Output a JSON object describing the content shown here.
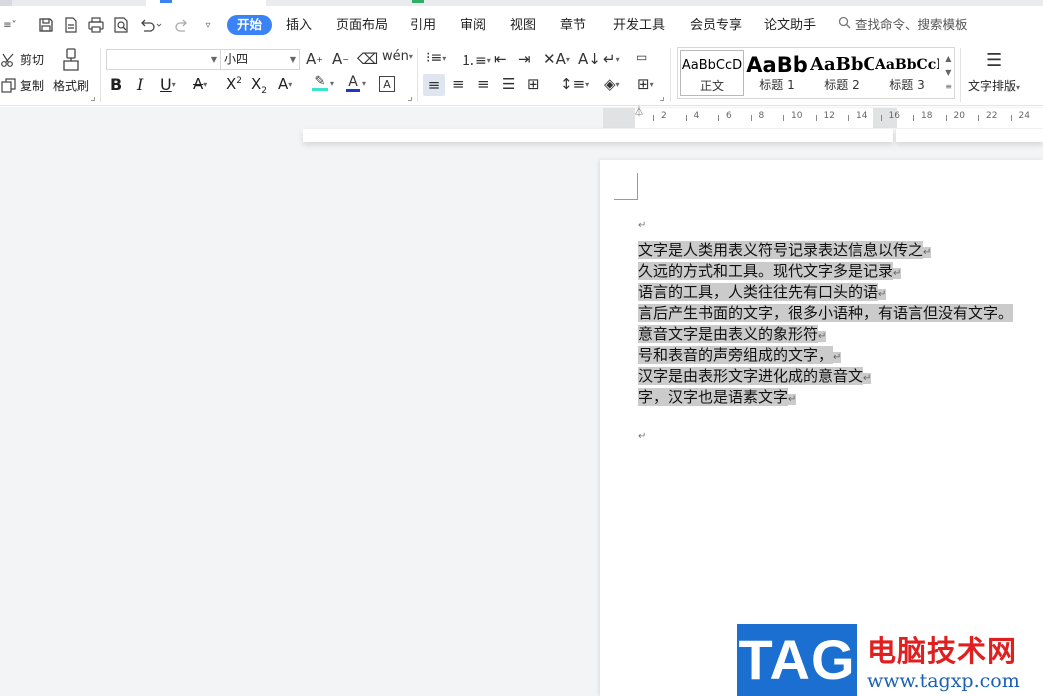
{
  "colors": {
    "accent": "#3a83f7",
    "selection": "#cbcbcb",
    "workspace": "#f3f4f5",
    "watermark_blue": "#1a6fd0",
    "watermark_red": "#e02020"
  },
  "menu": {
    "tabs": [
      "开始",
      "插入",
      "页面布局",
      "引用",
      "审阅",
      "视图",
      "章节",
      "开发工具",
      "会员专享",
      "论文助手"
    ],
    "active_tab": "开始",
    "search_label": "查找命令、搜索模板"
  },
  "quick_access": {
    "icons": [
      "save-icon",
      "export-pdf-icon",
      "print-icon",
      "print-preview-icon",
      "undo-icon",
      "redo-icon",
      "customize-icon"
    ]
  },
  "ribbon": {
    "cut_label": "剪切",
    "copy_label": "复制",
    "format_painter_label": "格式刷",
    "font_name_value": "",
    "font_size_value": "小四",
    "styles": [
      {
        "sample": "AaBbCcD",
        "name": "正文"
      },
      {
        "sample": "AaBb",
        "name": "标题 1"
      },
      {
        "sample": "AaBbC",
        "name": "标题 2"
      },
      {
        "sample": "AaBbCcI",
        "name": "标题 3"
      }
    ],
    "text_layout_label": "文字排版"
  },
  "ruler": {
    "labels": [
      "2",
      "4",
      "6",
      "8",
      "10",
      "12",
      "14",
      "16",
      "18",
      "20",
      "22",
      "24"
    ]
  },
  "document": {
    "paragraph_mark": "↵",
    "lines": [
      "文字是人类用表义符号记录表达信息以传之",
      "久远的方式和工具。现代文字多是记录",
      "语言的工具，人类往往先有口头的语",
      "言后产生书面的文字，很多小语种，有语言但没有文字。",
      "意音文字是由表义的象形符",
      "号和表音的声旁组成的文字，",
      "汉字是由表形文字进化成的意音文",
      "字，汉字也是语素文字"
    ]
  },
  "watermark": {
    "logo": "TAG",
    "title": "电脑技术网",
    "url": "www.tagxp.com"
  }
}
